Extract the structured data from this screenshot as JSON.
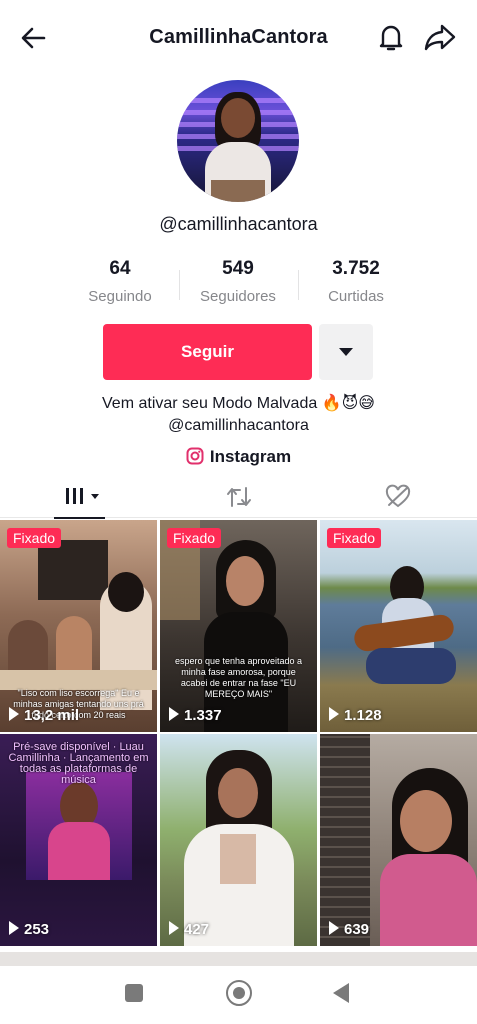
{
  "header": {
    "title": "CamillinhaCantora",
    "icons": [
      "back-arrow-icon",
      "bell-icon",
      "share-icon"
    ]
  },
  "profile": {
    "username": "@camillinhacantora",
    "stats": [
      {
        "value": "64",
        "label": "Seguindo"
      },
      {
        "value": "549",
        "label": "Seguidores"
      },
      {
        "value": "3.752",
        "label": "Curtidas"
      }
    ],
    "follow_label": "Seguir",
    "bio_line1": "Vem ativar seu Modo Malvada 🔥😈😅",
    "bio_line2": "@camillinhacantora",
    "link_label": "Instagram"
  },
  "tabs": [
    {
      "name": "videos",
      "icon": "grid-icon",
      "active": true
    },
    {
      "name": "reposts",
      "icon": "repost-icon",
      "active": false
    },
    {
      "name": "liked",
      "icon": "liked-hidden-icon",
      "active": false
    }
  ],
  "videos": [
    {
      "views": "13,2 mil",
      "pinned": true,
      "pinned_label": "Fixado",
      "caption": "\"Liso com liso escorrega\" Eu e minhas amigas tentando uns prá tudo certo com 20 reais"
    },
    {
      "views": "1.337",
      "pinned": true,
      "pinned_label": "Fixado",
      "caption": "espero que tenha aproveitado a minha fase amorosa, porque acabei de entrar na fase \"EU MEREÇO MAIS\""
    },
    {
      "views": "1.128",
      "pinned": true,
      "pinned_label": "Fixado",
      "caption": ""
    },
    {
      "views": "253",
      "pinned": false,
      "caption": "Pré-save disponível · Luau Camillinha · Lançamento em todas as plataformas de música"
    },
    {
      "views": "427",
      "pinned": false,
      "caption": ""
    },
    {
      "views": "639",
      "pinned": false,
      "caption": ""
    }
  ],
  "colors": {
    "accent": "#fe2c55",
    "text": "#161823",
    "muted": "#86878b"
  }
}
